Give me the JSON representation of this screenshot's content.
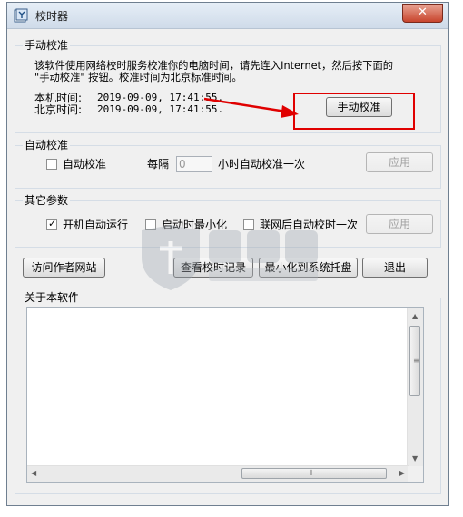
{
  "window": {
    "title": "校时器",
    "close_glyph": "✕"
  },
  "manual": {
    "group_label": "手动校准",
    "desc_line1": "该软件使用网络校时服务校准你的电脑时间，请先连入Internet，然后按下面的",
    "desc_line2": "\"手动校准\" 按钮。校准时间为北京标准时间。",
    "local_label": "本机时间:",
    "local_value": "2019-09-09, 17:41:55.",
    "beijing_label": "北京时间:",
    "beijing_value": "2019-09-09, 17:41:55.",
    "button_label": "手动校准"
  },
  "auto": {
    "group_label": "自动校准",
    "checkbox_label": "自动校准",
    "checked": false,
    "every_label": "每隔",
    "interval_value": "0",
    "interval_suffix": "小时自动校准一次",
    "apply_label": "应用"
  },
  "other": {
    "group_label": "其它参数",
    "opt1_label": "开机自动运行",
    "opt1_checked": true,
    "opt2_label": "启动时最小化",
    "opt2_checked": false,
    "opt3_label": "联网后自动校时一次",
    "opt3_checked": false,
    "apply_label": "应用"
  },
  "actions": {
    "visit_label": "访问作者网站",
    "log_label": "查看校时记录",
    "tray_label": "最小化到系统托盘",
    "exit_label": "退出"
  },
  "about": {
    "group_label": "关于本软件",
    "content": ""
  },
  "check_glyph": "✓",
  "colors": {
    "highlight": "#e00000",
    "titlebar": "#dbe5f1",
    "close": "#c8452d"
  }
}
